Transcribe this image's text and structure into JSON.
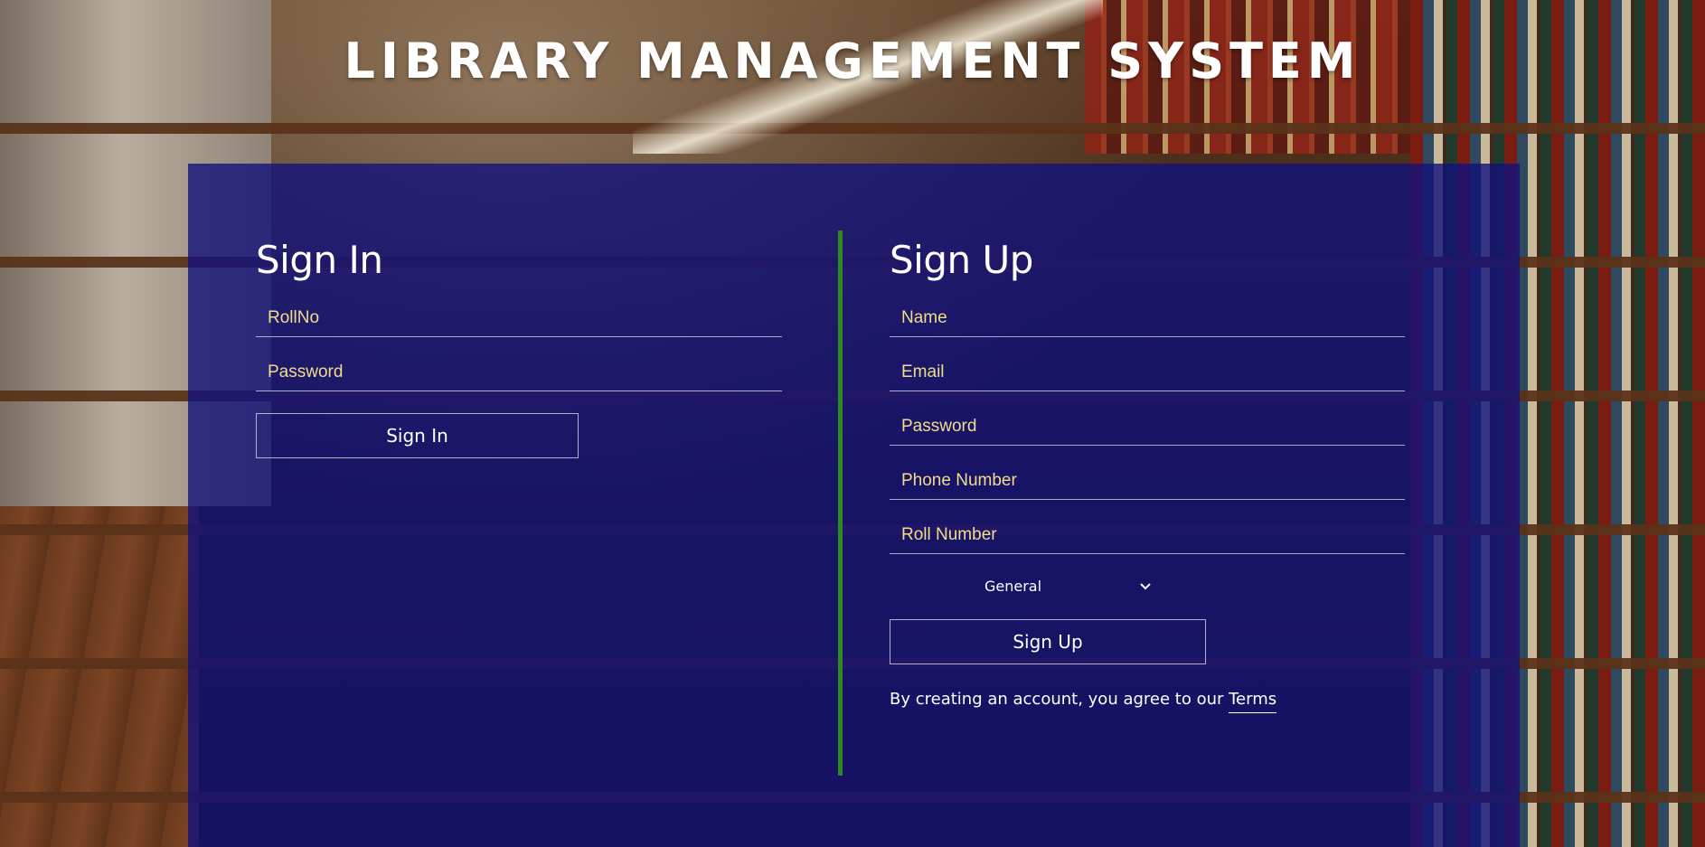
{
  "header": {
    "title": "LIBRARY MANAGEMENT SYSTEM"
  },
  "colors": {
    "panel": "#12127a",
    "divider": "#2e8b1e",
    "placeholder": "#f0dd8a",
    "text": "#ffffff"
  },
  "signin": {
    "title": "Sign In",
    "rollno_placeholder": "RollNo",
    "password_placeholder": "Password",
    "button_label": "Sign In"
  },
  "signup": {
    "title": "Sign Up",
    "name_placeholder": "Name",
    "email_placeholder": "Email",
    "password_placeholder": "Password",
    "phone_placeholder": "Phone Number",
    "roll_placeholder": "Roll Number",
    "category_selected": "General",
    "category_icon": "chevron-down-icon",
    "button_label": "Sign Up",
    "terms_text": "By creating an account, you agree to our ",
    "terms_link": "Terms"
  }
}
